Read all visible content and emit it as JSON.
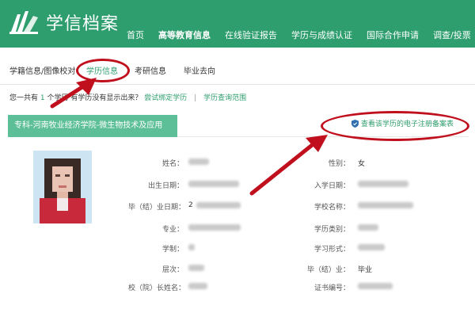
{
  "header": {
    "logo_text": "学信档案",
    "nav": [
      {
        "label": "首页"
      },
      {
        "label": "高等教育信息"
      },
      {
        "label": "在线验证报告"
      },
      {
        "label": "学历与成绩认证"
      },
      {
        "label": "国际合作申请"
      },
      {
        "label": "调查/投票"
      }
    ],
    "active_nav": "高等教育信息"
  },
  "subnav": {
    "items": [
      {
        "label": "学籍信息/图像校对"
      },
      {
        "label": "学历信息"
      },
      {
        "label": "考研信息"
      },
      {
        "label": "毕业去向"
      }
    ],
    "active": "学历信息"
  },
  "info": {
    "prefix": "您一共有",
    "count": "1",
    "suffix": "个学历",
    "question": "有学历没有显示出来？",
    "bind_link": "尝试绑定学历",
    "separator": "|",
    "scope_link": "学历查询范围"
  },
  "record": {
    "title": "专科-河南牧业经济学院-微生物技术及应用",
    "registration_link": "查看该学历的电子注册备案表",
    "fields_left": [
      {
        "label": "姓名：",
        "value": ""
      },
      {
        "label": "出生日期：",
        "value": ""
      },
      {
        "label": "毕（结）业日期：",
        "value": "2"
      },
      {
        "label": "专业：",
        "value": ""
      },
      {
        "label": "学制：",
        "value": ""
      },
      {
        "label": "层次：",
        "value": ""
      },
      {
        "label": "校（院）长姓名：",
        "value": ""
      }
    ],
    "fields_right": [
      {
        "label": "性别：",
        "value": "女"
      },
      {
        "label": "入学日期：",
        "value": ""
      },
      {
        "label": "学校名称：",
        "value": ""
      },
      {
        "label": "学历类别：",
        "value": ""
      },
      {
        "label": "学习形式：",
        "value": ""
      },
      {
        "label": "毕（结）业：",
        "value": "毕业"
      },
      {
        "label": "证书编号：",
        "value": ""
      }
    ]
  },
  "colors": {
    "brand_green": "#2f9e6e",
    "banner_green": "#5cbf98",
    "annotation_red": "#c0101d"
  }
}
